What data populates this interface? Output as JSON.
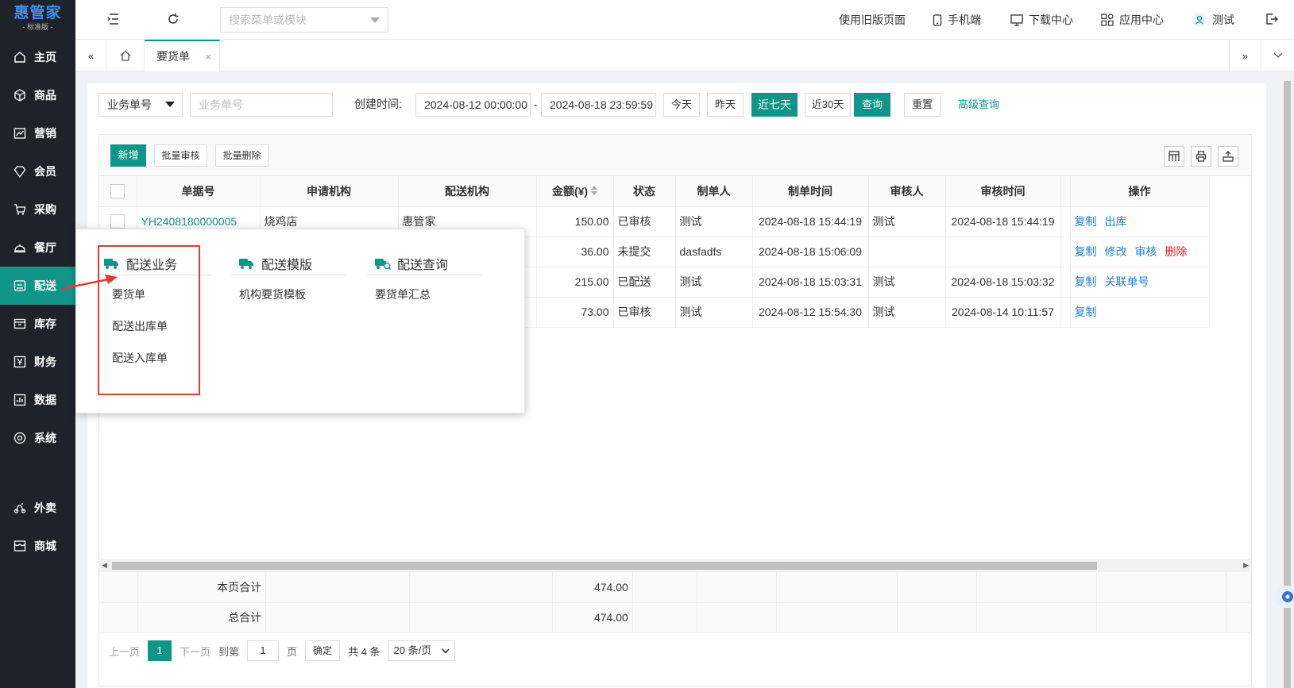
{
  "brand": {
    "name": "惠管家",
    "edition": "- 标准版 -"
  },
  "sidebar": {
    "items": [
      {
        "label": "主页",
        "icon": "home-icon"
      },
      {
        "label": "商品",
        "icon": "cube-icon"
      },
      {
        "label": "营销",
        "icon": "trend-icon"
      },
      {
        "label": "会员",
        "icon": "diamond-icon"
      },
      {
        "label": "采购",
        "icon": "cart-icon"
      },
      {
        "label": "餐厅",
        "icon": "dish-icon"
      },
      {
        "label": "配送",
        "icon": "truck-icon"
      },
      {
        "label": "库存",
        "icon": "warehouse-icon"
      },
      {
        "label": "财务",
        "icon": "yen-icon"
      },
      {
        "label": "数据",
        "icon": "bar-chart-icon"
      },
      {
        "label": "系统",
        "icon": "settings-icon"
      },
      {
        "label": "外卖",
        "icon": "scooter-icon"
      },
      {
        "label": "商城",
        "icon": "store-icon"
      }
    ],
    "active_index": 6
  },
  "topbar": {
    "search_placeholder": "搜索菜单或模块",
    "old_page": "使用旧版页面",
    "mobile": "手机端",
    "download": "下载中心",
    "apps": "应用中心",
    "user": "测试"
  },
  "tabs": {
    "active": "要货单",
    "close": "×"
  },
  "filter": {
    "field_select": "业务单号",
    "field_placeholder": "业务单号",
    "created_label": "创建时间:",
    "date_from": "2024-08-12 00:00:00",
    "date_sep": "-",
    "date_to": "2024-08-18 23:59:59",
    "today": "今天",
    "yesterday": "昨天",
    "last7": "近七天",
    "last30": "近30天",
    "query": "查询",
    "reset": "重置",
    "advanced": "高级查询"
  },
  "toolbar": {
    "add": "新增",
    "batch_audit": "批量审核",
    "batch_delete": "批量删除"
  },
  "table": {
    "columns": [
      "单据号",
      "申请机构",
      "配送机构",
      "金额(¥)",
      "状态",
      "制单人",
      "制单时间",
      "审核人",
      "审核时间",
      "操作"
    ],
    "rows": [
      {
        "no": "YH2408180000005",
        "apply": "烧鸡店",
        "dist": "惠管家",
        "amount": "150.00",
        "status": "已审核",
        "maker": "测试",
        "make_time": "2024-08-18 15:44:19",
        "auditor": "测试",
        "audit_time": "2024-08-18 15:44:19",
        "ops": [
          "复制",
          "出库"
        ]
      },
      {
        "no": "",
        "apply": "",
        "dist": "",
        "amount": "36.00",
        "status": "未提交",
        "maker": "dasfadfs",
        "make_time": "2024-08-18 15:06:09",
        "auditor": "",
        "audit_time": "",
        "ops": [
          "复制",
          "修改",
          "审核",
          "删除"
        ]
      },
      {
        "no": "",
        "apply": "",
        "dist": "",
        "amount": "215.00",
        "status": "已配送",
        "maker": "测试",
        "make_time": "2024-08-18 15:03:31",
        "auditor": "测试",
        "audit_time": "2024-08-18 15:03:32",
        "ops": [
          "复制",
          "关联单号"
        ]
      },
      {
        "no": "",
        "apply": "",
        "dist": "",
        "amount": "73.00",
        "status": "已审核",
        "maker": "测试",
        "make_time": "2024-08-12 15:54:30",
        "auditor": "测试",
        "audit_time": "2024-08-14 10:11:57",
        "ops": [
          "复制"
        ]
      }
    ],
    "page_total_label": "本页合计",
    "page_total": "474.00",
    "grand_total_label": "总合计",
    "grand_total": "474.00"
  },
  "pager": {
    "prev": "上一页",
    "current": "1",
    "next": "下一页",
    "goto": "到第",
    "goto_value": "1",
    "page_unit": "页",
    "confirm": "确定",
    "total": "共 4 条",
    "page_size": "20 条/页"
  },
  "menu_popup": {
    "columns": [
      {
        "title": "配送业务",
        "icon": "truck-icon",
        "items": [
          "要货单",
          "配送出库单",
          "配送入库单"
        ]
      },
      {
        "title": "配送模版",
        "icon": "truck-icon",
        "items": [
          "机构要货模板"
        ]
      },
      {
        "title": "配送查询",
        "icon": "truck-search-icon",
        "items": [
          "要货单汇总"
        ]
      }
    ]
  },
  "colors": {
    "primary": "#0f9688",
    "sidebar": "#1f2329",
    "link": "#1e7fd3",
    "danger": "#e02020",
    "annotation": "#e53935"
  }
}
